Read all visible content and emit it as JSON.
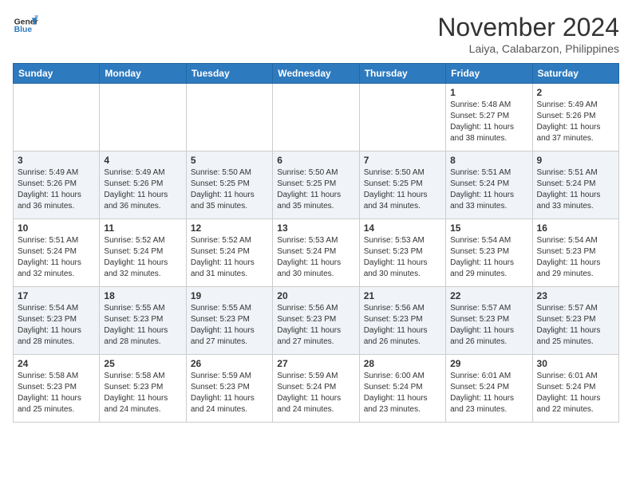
{
  "header": {
    "logo_line1": "General",
    "logo_line2": "Blue",
    "month": "November 2024",
    "location": "Laiya, Calabarzon, Philippines"
  },
  "weekdays": [
    "Sunday",
    "Monday",
    "Tuesday",
    "Wednesday",
    "Thursday",
    "Friday",
    "Saturday"
  ],
  "weeks": [
    [
      {
        "day": "",
        "text": ""
      },
      {
        "day": "",
        "text": ""
      },
      {
        "day": "",
        "text": ""
      },
      {
        "day": "",
        "text": ""
      },
      {
        "day": "",
        "text": ""
      },
      {
        "day": "1",
        "text": "Sunrise: 5:48 AM\nSunset: 5:27 PM\nDaylight: 11 hours\nand 38 minutes."
      },
      {
        "day": "2",
        "text": "Sunrise: 5:49 AM\nSunset: 5:26 PM\nDaylight: 11 hours\nand 37 minutes."
      }
    ],
    [
      {
        "day": "3",
        "text": "Sunrise: 5:49 AM\nSunset: 5:26 PM\nDaylight: 11 hours\nand 36 minutes."
      },
      {
        "day": "4",
        "text": "Sunrise: 5:49 AM\nSunset: 5:26 PM\nDaylight: 11 hours\nand 36 minutes."
      },
      {
        "day": "5",
        "text": "Sunrise: 5:50 AM\nSunset: 5:25 PM\nDaylight: 11 hours\nand 35 minutes."
      },
      {
        "day": "6",
        "text": "Sunrise: 5:50 AM\nSunset: 5:25 PM\nDaylight: 11 hours\nand 35 minutes."
      },
      {
        "day": "7",
        "text": "Sunrise: 5:50 AM\nSunset: 5:25 PM\nDaylight: 11 hours\nand 34 minutes."
      },
      {
        "day": "8",
        "text": "Sunrise: 5:51 AM\nSunset: 5:24 PM\nDaylight: 11 hours\nand 33 minutes."
      },
      {
        "day": "9",
        "text": "Sunrise: 5:51 AM\nSunset: 5:24 PM\nDaylight: 11 hours\nand 33 minutes."
      }
    ],
    [
      {
        "day": "10",
        "text": "Sunrise: 5:51 AM\nSunset: 5:24 PM\nDaylight: 11 hours\nand 32 minutes."
      },
      {
        "day": "11",
        "text": "Sunrise: 5:52 AM\nSunset: 5:24 PM\nDaylight: 11 hours\nand 32 minutes."
      },
      {
        "day": "12",
        "text": "Sunrise: 5:52 AM\nSunset: 5:24 PM\nDaylight: 11 hours\nand 31 minutes."
      },
      {
        "day": "13",
        "text": "Sunrise: 5:53 AM\nSunset: 5:24 PM\nDaylight: 11 hours\nand 30 minutes."
      },
      {
        "day": "14",
        "text": "Sunrise: 5:53 AM\nSunset: 5:23 PM\nDaylight: 11 hours\nand 30 minutes."
      },
      {
        "day": "15",
        "text": "Sunrise: 5:54 AM\nSunset: 5:23 PM\nDaylight: 11 hours\nand 29 minutes."
      },
      {
        "day": "16",
        "text": "Sunrise: 5:54 AM\nSunset: 5:23 PM\nDaylight: 11 hours\nand 29 minutes."
      }
    ],
    [
      {
        "day": "17",
        "text": "Sunrise: 5:54 AM\nSunset: 5:23 PM\nDaylight: 11 hours\nand 28 minutes."
      },
      {
        "day": "18",
        "text": "Sunrise: 5:55 AM\nSunset: 5:23 PM\nDaylight: 11 hours\nand 28 minutes."
      },
      {
        "day": "19",
        "text": "Sunrise: 5:55 AM\nSunset: 5:23 PM\nDaylight: 11 hours\nand 27 minutes."
      },
      {
        "day": "20",
        "text": "Sunrise: 5:56 AM\nSunset: 5:23 PM\nDaylight: 11 hours\nand 27 minutes."
      },
      {
        "day": "21",
        "text": "Sunrise: 5:56 AM\nSunset: 5:23 PM\nDaylight: 11 hours\nand 26 minutes."
      },
      {
        "day": "22",
        "text": "Sunrise: 5:57 AM\nSunset: 5:23 PM\nDaylight: 11 hours\nand 26 minutes."
      },
      {
        "day": "23",
        "text": "Sunrise: 5:57 AM\nSunset: 5:23 PM\nDaylight: 11 hours\nand 25 minutes."
      }
    ],
    [
      {
        "day": "24",
        "text": "Sunrise: 5:58 AM\nSunset: 5:23 PM\nDaylight: 11 hours\nand 25 minutes."
      },
      {
        "day": "25",
        "text": "Sunrise: 5:58 AM\nSunset: 5:23 PM\nDaylight: 11 hours\nand 24 minutes."
      },
      {
        "day": "26",
        "text": "Sunrise: 5:59 AM\nSunset: 5:23 PM\nDaylight: 11 hours\nand 24 minutes."
      },
      {
        "day": "27",
        "text": "Sunrise: 5:59 AM\nSunset: 5:24 PM\nDaylight: 11 hours\nand 24 minutes."
      },
      {
        "day": "28",
        "text": "Sunrise: 6:00 AM\nSunset: 5:24 PM\nDaylight: 11 hours\nand 23 minutes."
      },
      {
        "day": "29",
        "text": "Sunrise: 6:01 AM\nSunset: 5:24 PM\nDaylight: 11 hours\nand 23 minutes."
      },
      {
        "day": "30",
        "text": "Sunrise: 6:01 AM\nSunset: 5:24 PM\nDaylight: 11 hours\nand 22 minutes."
      }
    ]
  ]
}
